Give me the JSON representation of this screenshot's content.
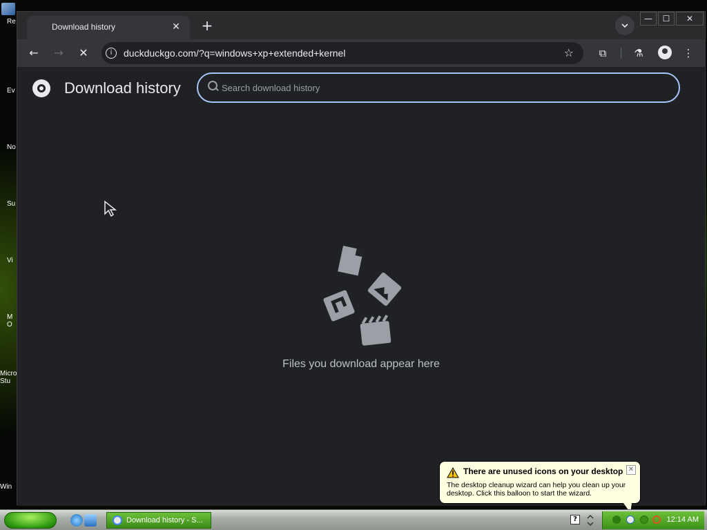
{
  "desktop": {
    "icon_labels": [
      "Re",
      "Ev",
      "No",
      "Su",
      "Vi",
      "M\nO",
      "Micro\nStu",
      "Win"
    ]
  },
  "browser": {
    "tab": {
      "title": "Download history",
      "close": "✕"
    },
    "new_tab": "+",
    "window_controls": {
      "minimize": "—",
      "maximize": "☐",
      "close": "✕"
    },
    "toolbar": {
      "back": "←",
      "forward": "→",
      "stop": "✕",
      "url": "duckduckgo.com/?q=windows+xp+extended+kernel",
      "bookmark": "☆",
      "extensions": "⧉",
      "labs": "⚗",
      "menu": "⋮"
    },
    "page": {
      "title": "Download history",
      "search_placeholder": "Search download history",
      "empty_message": "Files you download appear here"
    }
  },
  "balloon": {
    "title": "There are unused icons on your desktop",
    "text": "The desktop cleanup wizard can help you clean up your desktop. Click this balloon to start the wizard.",
    "close": "✕"
  },
  "taskbar": {
    "task_label": "Download history - S...",
    "help": "?",
    "clock": "12:14 AM"
  },
  "colors": {
    "page_bg": "#202124",
    "search_border": "#a8c7fa",
    "taskbar_green": "#3a8a18",
    "balloon_bg": "#ffffe1"
  }
}
